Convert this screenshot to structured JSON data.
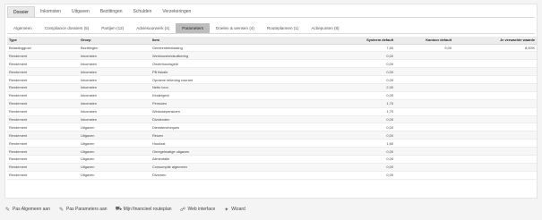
{
  "top_tabs": [
    {
      "label": "Dossier",
      "active": true
    },
    {
      "label": "Inkomsten",
      "active": false
    },
    {
      "label": "Uitgaven",
      "active": false
    },
    {
      "label": "Bezittingen",
      "active": false
    },
    {
      "label": "Schulden",
      "active": false
    },
    {
      "label": "Verzekeringen",
      "active": false
    }
  ],
  "sub_tabs": [
    {
      "label": "Algemeen",
      "active": false
    },
    {
      "label": "Compliance dossiers (5)",
      "active": false
    },
    {
      "label": "Partijen (12)",
      "active": false
    },
    {
      "label": "Adviesuurwerk (4)",
      "active": false
    },
    {
      "label": "Parameters",
      "active": true
    },
    {
      "label": "Doelen & wensen (4)",
      "active": false
    },
    {
      "label": "Routeplannen (1)",
      "active": false
    },
    {
      "label": "Actiepunten (8)",
      "active": false
    }
  ],
  "table": {
    "headers": {
      "type": "Type",
      "groep": "Groep",
      "item": "Item",
      "system_default": "Systeem default",
      "kantoor_default": "Kantoor default",
      "verwachte_waarde": "Je verwachte waarde"
    },
    "rows": [
      {
        "type": "Belastinggroei",
        "groep": "Bezittingen",
        "item": "Gemeentebelasting",
        "system": "7,50",
        "kantoor": "9,00",
        "verwacht": "8,00%"
      },
      {
        "type": "Rendement",
        "groep": "Inkomsten",
        "item": "Werkloosheidsuitkering",
        "system": "0,00",
        "kantoor": "",
        "verwacht": ""
      },
      {
        "type": "Rendement",
        "groep": "Inkomsten",
        "item": "Onderhoudsgeld",
        "system": "0,00",
        "kantoor": "",
        "verwacht": ""
      },
      {
        "type": "Rendement",
        "groep": "Inkomsten",
        "item": "PB fiskale",
        "system": "0,00",
        "kantoor": "",
        "verwacht": ""
      },
      {
        "type": "Rendement",
        "groep": "Inkomsten",
        "item": "Opname rekening courant",
        "system": "0,00",
        "kantoor": "",
        "verwacht": ""
      },
      {
        "type": "Rendement",
        "groep": "Inkomsten",
        "item": "Netto loon",
        "system": "2,00",
        "kantoor": "",
        "verwacht": ""
      },
      {
        "type": "Rendement",
        "groep": "Inkomsten",
        "item": "Kindergeld",
        "system": "0,00",
        "kantoor": "",
        "verwacht": ""
      },
      {
        "type": "Rendement",
        "groep": "Inkomsten",
        "item": "Pensioen",
        "system": "1,70",
        "kantoor": "",
        "verwacht": ""
      },
      {
        "type": "Rendement",
        "groep": "Inkomsten",
        "item": "Weduwepensioen",
        "system": "1,70",
        "kantoor": "",
        "verwacht": ""
      },
      {
        "type": "Rendement",
        "groep": "Inkomsten",
        "item": "Dividenden",
        "system": "0,00",
        "kantoor": "",
        "verwacht": ""
      },
      {
        "type": "Rendement",
        "groep": "Uitgaven",
        "item": "Dienstencheques",
        "system": "0,00",
        "kantoor": "",
        "verwacht": ""
      },
      {
        "type": "Rendement",
        "groep": "Uitgaven",
        "item": "Reizen",
        "system": "0,00",
        "kantoor": "",
        "verwacht": ""
      },
      {
        "type": "Rendement",
        "groep": "Uitgaven",
        "item": "Huurlast",
        "system": "1,60",
        "kantoor": "",
        "verwacht": ""
      },
      {
        "type": "Rendement",
        "groep": "Uitgaven",
        "item": "Onregelmatige uitgaven",
        "system": "0,00",
        "kantoor": "",
        "verwacht": ""
      },
      {
        "type": "Rendement",
        "groep": "Uitgaven",
        "item": "Alimentatie",
        "system": "0,00",
        "kantoor": "",
        "verwacht": ""
      },
      {
        "type": "Rendement",
        "groep": "Uitgaven",
        "item": "Consumptie algemeen",
        "system": "0,00",
        "kantoor": "",
        "verwacht": ""
      },
      {
        "type": "Rendement",
        "groep": "Uitgaven",
        "item": "Diversen",
        "system": "0,00",
        "kantoor": "",
        "verwacht": ""
      }
    ]
  },
  "actions": [
    {
      "icon": "edit-icon",
      "glyph": "✎",
      "label": "Pas Algemeen aan"
    },
    {
      "icon": "edit-icon",
      "glyph": "✎",
      "label": "Pas Parameters aan"
    },
    {
      "icon": "road-icon",
      "glyph": "⛟",
      "label": "Mijn financieel routeplan"
    },
    {
      "icon": "sitemap-icon",
      "glyph": "☍",
      "label": "Web interface"
    },
    {
      "icon": "magic-wand-icon",
      "glyph": "✦",
      "label": "Wizard"
    }
  ]
}
